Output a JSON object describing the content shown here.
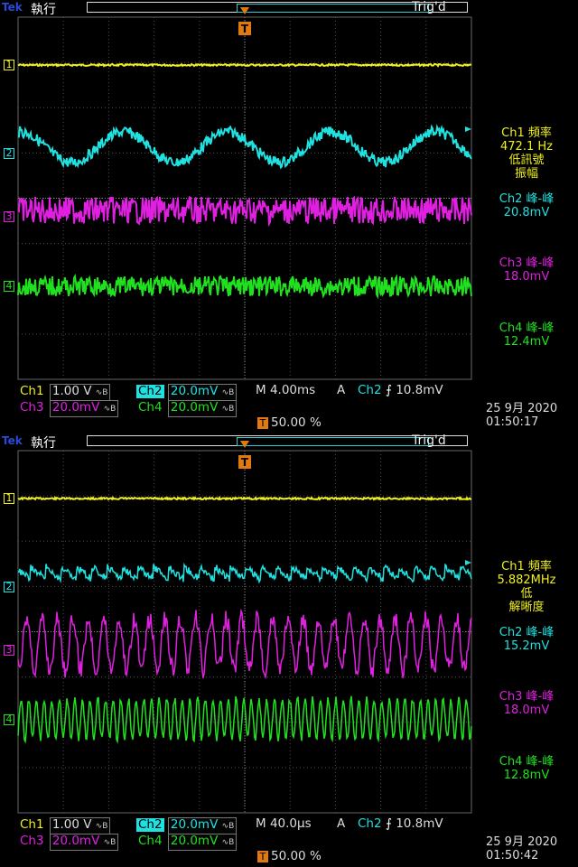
{
  "colors": {
    "ch1": "#f0f020",
    "ch2": "#20e0e0",
    "ch3": "#e020e0",
    "ch4": "#20e020",
    "trigger": "#e07a10",
    "grid": "#505050"
  },
  "channel_markers": [
    "1",
    "2",
    "3",
    "4"
  ],
  "trigger_marker": "T",
  "screens": [
    {
      "brand": "Tek",
      "run_state": "執行",
      "trig_state": "Trig'd",
      "measurements": [
        {
          "lines": [
            "Ch1 頻率",
            "472.1 Hz",
            "低訊號",
            "振幅"
          ],
          "color": "#f0f020"
        },
        {
          "lines": [
            "Ch2 峰-峰",
            "20.8mV"
          ],
          "color": "#20e0e0"
        },
        {
          "lines": [
            "Ch3 峰-峰",
            "18.0mV"
          ],
          "color": "#e020e0"
        },
        {
          "lines": [
            "Ch4 峰-峰",
            "12.4mV"
          ],
          "color": "#20e020"
        }
      ],
      "status": {
        "ch1_label": "Ch1",
        "ch1_scale": "1.00 V",
        "ch2_label": "Ch2",
        "ch2_scale": "20.0mV",
        "ch3_label": "Ch3",
        "ch3_scale": "20.0mV",
        "ch4_label": "Ch4",
        "ch4_scale": "20.0mV",
        "timebase": "M 4.00ms",
        "trig_mode": "A",
        "trig_source": "Ch2",
        "trig_level": "10.8mV",
        "trig_position": "50.00 %",
        "date": "25 9月  2020",
        "time": "01:50:17"
      },
      "wave_style": "sine"
    },
    {
      "brand": "Tek",
      "run_state": "執行",
      "trig_state": "Trig'd",
      "measurements": [
        {
          "lines": [
            "Ch1 頻率",
            "5.882MHz",
            "低",
            "解晰度"
          ],
          "color": "#f0f020"
        },
        {
          "lines": [
            "Ch2 峰-峰",
            "15.2mV"
          ],
          "color": "#20e0e0"
        },
        {
          "lines": [
            "Ch3 峰-峰",
            "18.0mV"
          ],
          "color": "#e020e0"
        },
        {
          "lines": [
            "Ch4 峰-峰",
            "12.8mV"
          ],
          "color": "#20e020"
        }
      ],
      "status": {
        "ch1_label": "Ch1",
        "ch1_scale": "1.00 V",
        "ch2_label": "Ch2",
        "ch2_scale": "20.0mV",
        "ch3_label": "Ch3",
        "ch3_scale": "20.0mV",
        "ch4_label": "Ch4",
        "ch4_scale": "20.0mV",
        "timebase": "M 40.0µs",
        "trig_mode": "A",
        "trig_source": "Ch2",
        "trig_level": "10.8mV",
        "trig_position": "50.00 %",
        "date": "25 9月  2020",
        "time": "01:50:42"
      },
      "wave_style": "sawtooth"
    }
  ]
}
